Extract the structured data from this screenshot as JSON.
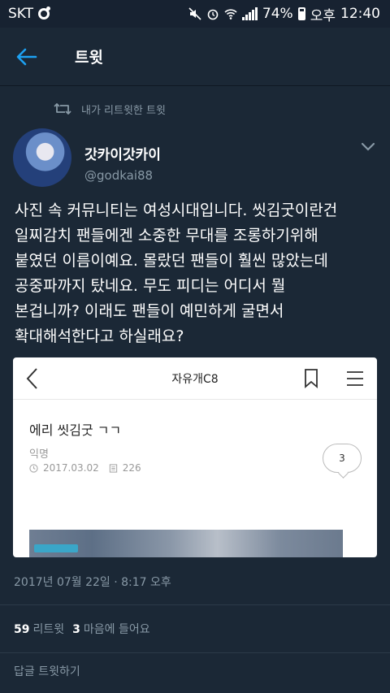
{
  "status_bar": {
    "carrier": "SKT",
    "battery": "74%",
    "ampm": "오후",
    "time": "12:40"
  },
  "header": {
    "title": "트윗"
  },
  "retweet_notice": "내가 리트윗한 트윗",
  "user": {
    "display_name": "갓카이갓카이",
    "handle": "@godkai88"
  },
  "tweet": {
    "text": "사진 속 커뮤니티는 여성시대입니다. 씻김굿이란건\n일찌감치 팬들에겐 소중한 무대를 조롱하기위해\n붙였던 이름이예요. 몰랐던 팬들이 훨씬 많았는데\n공중파까지 탔네요. 무도 피디는 어디서 뭘\n본겁니까? 이래도 팬들이 예민하게 굴면서\n확대해석한다고 하실래요?"
  },
  "embedded": {
    "board_title": "자유개C8",
    "post_title": "에리 씻김굿 ㄱㄱ",
    "author": "익명",
    "date": "2017.03.02",
    "views": "226",
    "comments": "3"
  },
  "timestamp": "2017년 07월 22일 · 8:17 오후",
  "stats": {
    "retweets_count": "59",
    "retweets_label": "리트윗",
    "likes_count": "3",
    "likes_label": "마음에 들어요"
  },
  "reply": {
    "placeholder": "답글 트윗하기"
  },
  "colors": {
    "background": "#1b2836",
    "accent": "#1da1f2",
    "secondary_text": "#8899a6"
  }
}
